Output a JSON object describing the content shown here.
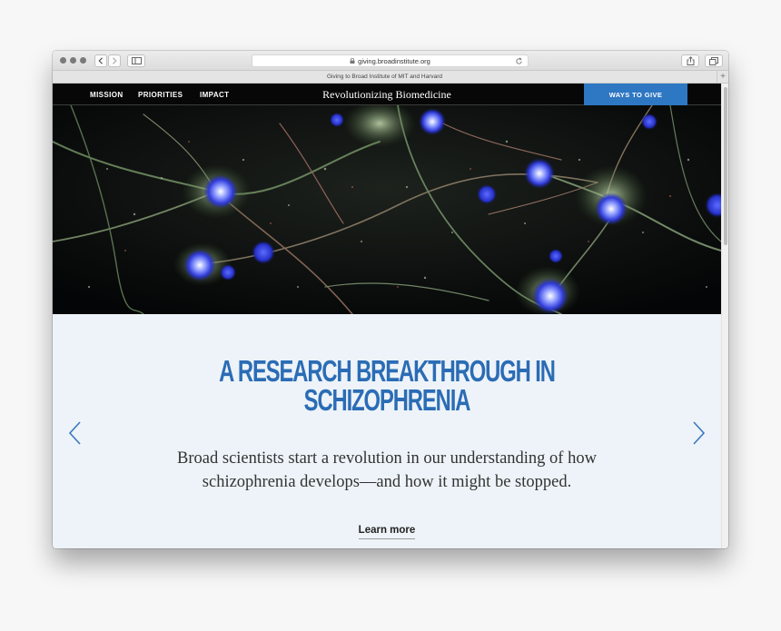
{
  "browser": {
    "url": "giving.broadinstitute.org",
    "tab_title": "Giving to Broad Institute of MIT and Harvard",
    "new_tab_label": "+"
  },
  "nav": {
    "links": [
      "MISSION",
      "PRIORITIES",
      "IMPACT"
    ],
    "site_title": "Revolutionizing Biomedicine",
    "cta_label": "WAYS TO GIVE"
  },
  "slide": {
    "headline_line1": "A RESEARCH BREAKTHROUGH IN",
    "headline_line2": "SCHIZOPHRENIA",
    "description": "Broad scientists start a revolution in our understanding of how schizophrenia develops—and how it might be stopped.",
    "cta": "Learn more"
  },
  "colors": {
    "accent": "#2b6cb5",
    "button_blue": "#2e77c2",
    "nav_bg": "#070707",
    "slide_bg": "#edf3f8"
  },
  "icons": {
    "prev": "chevron-left-icon",
    "next": "chevron-right-icon",
    "lock": "lock-icon",
    "reload": "reload-icon",
    "share": "share-icon",
    "tabs": "tabs-icon",
    "sidebar": "sidebar-icon"
  }
}
